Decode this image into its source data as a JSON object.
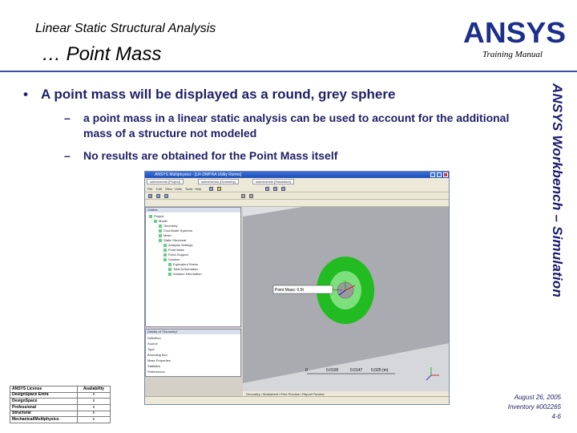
{
  "header": {
    "title": "Linear Static Structural Analysis",
    "subtitle": "… Point Mass",
    "logo_text": "ANSYS",
    "training_manual": "Training Manual"
  },
  "side_label": "ANSYS Workbench – Simulation",
  "content": {
    "bullet_marker": "•",
    "dash": "–",
    "bullet": "A point mass will be displayed as a round, grey sphere",
    "sub_bullets": [
      "a point mass in a linear static analysis can be used to account for the additional mass of a structure not modeled",
      "No results are obtained for the Point Mass itself"
    ]
  },
  "screenshot": {
    "window_title": "ANSYS Multiphysics - [LR-DMPRA Utility Rsrms]",
    "tabs": [
      "solmeromdu [Project]",
      "solmeromdu [Geometry]",
      "solmeromdu [Simulation]"
    ],
    "toolbar_items": [
      "File",
      "Edit",
      "View",
      "Units",
      "Tools",
      "Help"
    ],
    "tree_header": "Outline",
    "tree_nodes": [
      "Project",
      "Model",
      "Geometry",
      "Coordinate Systems",
      "Mesh",
      "Static Structural",
      "Analysis Settings",
      "Point Mass",
      "Fixed Support",
      "Solution",
      "Equivalent Stress",
      "Total Deformation",
      "Solution Information"
    ],
    "details_header": "Details of \"Geometry\"",
    "details_rows": [
      "Definition",
      "Source",
      "Type",
      "Bounding Box",
      "Mass Properties",
      "Statistics",
      "Preferences"
    ],
    "annotation": "Point Mass: 0.5t",
    "scale_labels": [
      "0",
      "0.0100",
      "0.0147",
      "0.025 (m)"
    ],
    "bottom_tabs": "Geometry / Worksheet / Print Preview / Report Preview"
  },
  "license_table": {
    "headers": [
      "ANSYS License",
      "Availability"
    ],
    "rows": [
      [
        "DesignSpace Entra",
        "x"
      ],
      [
        "DesignSpace",
        "x"
      ],
      [
        "Professional",
        "x"
      ],
      [
        "Structural",
        "x"
      ],
      [
        "Mechanical/Multiphysics",
        "x"
      ]
    ]
  },
  "footer": {
    "date": "August 26, 2005",
    "inventory": "Inventory #002265",
    "page": "4-6"
  },
  "colors": {
    "body_text": "#1f1f66",
    "header_rule": "#3b4fa0",
    "logo": "#1c2f8a",
    "point_mass_green": "#22bb22"
  }
}
